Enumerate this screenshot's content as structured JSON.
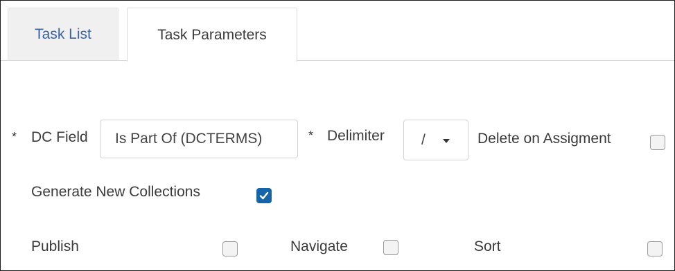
{
  "tabs": {
    "task_list": "Task List",
    "task_parameters": "Task Parameters"
  },
  "form": {
    "required_marker": "*",
    "dc_field": {
      "label": "DC Field",
      "value": "Is Part Of (DCTERMS)"
    },
    "delimiter": {
      "label": "Delimiter",
      "value": "/"
    },
    "delete_on_assignment": {
      "label": "Delete on Assigment",
      "checked": false
    },
    "generate_new_collections": {
      "label": "Generate New Collections",
      "checked": true
    },
    "publish": {
      "label": "Publish",
      "checked": false
    },
    "navigate": {
      "label": "Navigate",
      "checked": false
    },
    "sort": {
      "label": "Sort",
      "checked": false
    }
  },
  "colors": {
    "active_tab_text": "#3c3c3c",
    "inactive_tab_text": "#3a62a6",
    "checkbox_checked": "#1565a8"
  }
}
